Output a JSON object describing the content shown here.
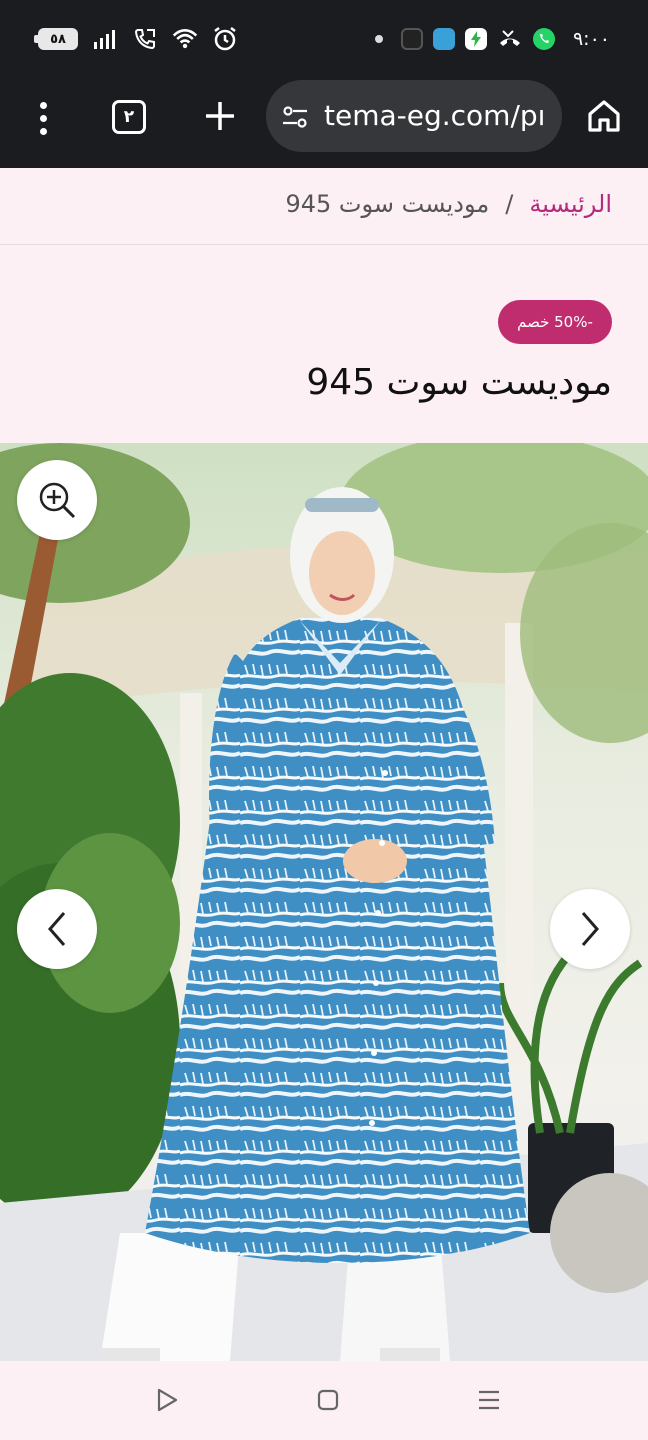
{
  "status_bar": {
    "battery": "٥٨",
    "clock": "٩:٠٠",
    "left_icons": [
      "signal-icon",
      "call-icon",
      "wifi-icon",
      "alarm-icon"
    ],
    "right_icons": [
      "notification-dot-icon",
      "app-icon-1",
      "app-icon-2",
      "app-icon-3",
      "missed-call-icon",
      "whatsapp-icon"
    ]
  },
  "browser": {
    "tab_count": "٢",
    "url": "tema-eg.com/pı",
    "icons": [
      "more-icon",
      "tabs-icon",
      "new-tab-icon",
      "site-settings-icon",
      "home-icon"
    ]
  },
  "breadcrumb": {
    "home": "الرئيسية",
    "separator": "/",
    "current": "موديست سوت 945"
  },
  "product": {
    "sale_badge": "-50% خصم",
    "title": "موديست سوت 945"
  },
  "gallery": {
    "icons": [
      "zoom-in-icon",
      "previous-arrow-icon",
      "next-arrow-icon"
    ]
  },
  "system_nav": {
    "icons": [
      "back-triangle-icon",
      "home-square-icon",
      "recents-menu-icon"
    ]
  },
  "colors": {
    "accent": "#c02d6f",
    "breadcrumb_link": "#b52a7b",
    "page_bg": "#fdf0f5",
    "system_bar": "#1b1c20"
  }
}
